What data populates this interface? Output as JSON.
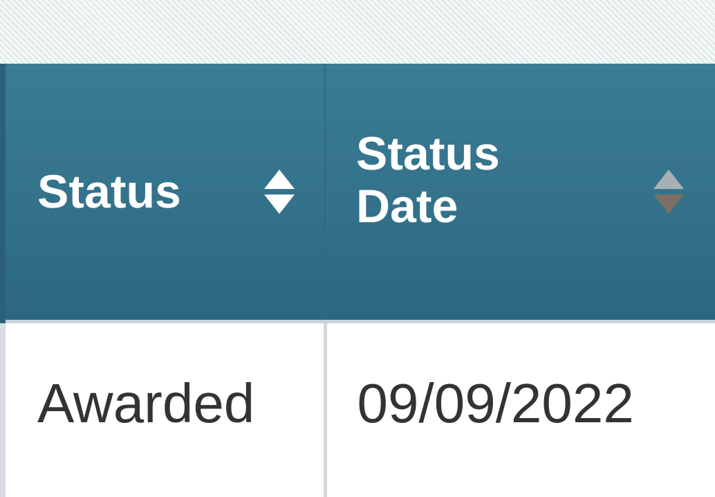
{
  "table": {
    "columns": [
      {
        "label": "Status",
        "sort_icon": "sort-both-icon",
        "sort_state": "unsorted"
      },
      {
        "label_line1": "Status",
        "label_line2": "Date",
        "sort_icon": "sort-both-icon",
        "sort_state": "unsorted-muted"
      }
    ],
    "rows": [
      {
        "status": "Awarded",
        "status_date": "09/09/2022"
      }
    ]
  },
  "colors": {
    "header_bg": "#33728a",
    "header_text": "#ffffff",
    "cell_text": "#333333",
    "sort_icon_active": "#ffffff",
    "sort_icon_muted_up": "#a9b0b4",
    "sort_icon_muted_down": "#7b7061"
  }
}
